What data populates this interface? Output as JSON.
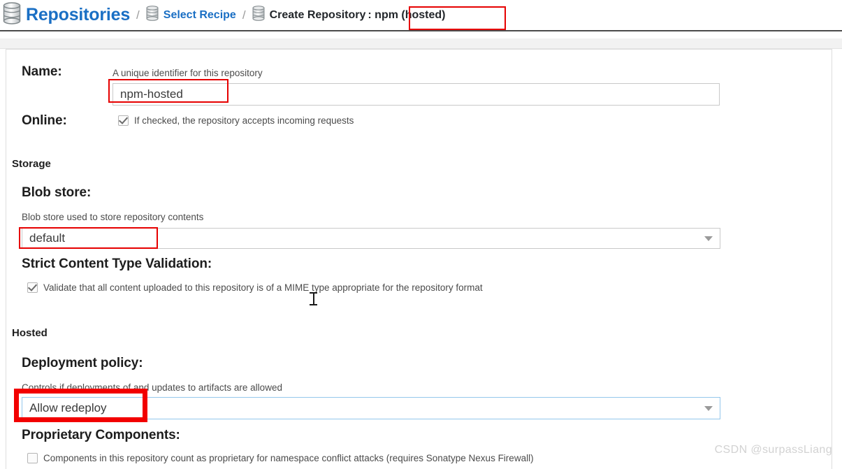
{
  "breadcrumb": {
    "root": "Repositories",
    "separator": "/",
    "recipe": "Select Recipe",
    "create": "Create Repository",
    "format": ": npm (hosted)",
    "root_icon": "database-icon",
    "recipe_icon": "database-icon",
    "create_icon": "database-icon"
  },
  "form": {
    "name": {
      "label": "Name:",
      "helper": "A unique identifier for this repository",
      "value": "npm-hosted"
    },
    "online": {
      "label": "Online:",
      "checkbox_text": "If checked, the repository accepts incoming requests",
      "checked": true
    },
    "storage": {
      "section": "Storage",
      "blob_store": {
        "label": "Blob store:",
        "helper": "Blob store used to store repository contents",
        "value": "default",
        "caret_icon": "chevron-down-icon"
      },
      "strict_validation": {
        "label": "Strict Content Type Validation:",
        "checkbox_text": "Validate that all content uploaded to this repository is of a MIME type appropriate for the repository format",
        "checked": true
      }
    },
    "hosted": {
      "section": "Hosted",
      "deployment_policy": {
        "label": "Deployment policy:",
        "helper": "Controls if deployments of and updates to artifacts are allowed",
        "value": "Allow redeploy",
        "caret_icon": "chevron-down-icon"
      },
      "proprietary_components": {
        "label": "Proprietary Components:",
        "checkbox_text": "Components in this repository count as proprietary for namespace conflict attacks (requires Sonatype Nexus Firewall)",
        "checked": false
      }
    }
  },
  "annotations": {
    "color": "#e60000",
    "thick_color": "#f20000"
  },
  "watermark": "CSDN @surpassLiang"
}
